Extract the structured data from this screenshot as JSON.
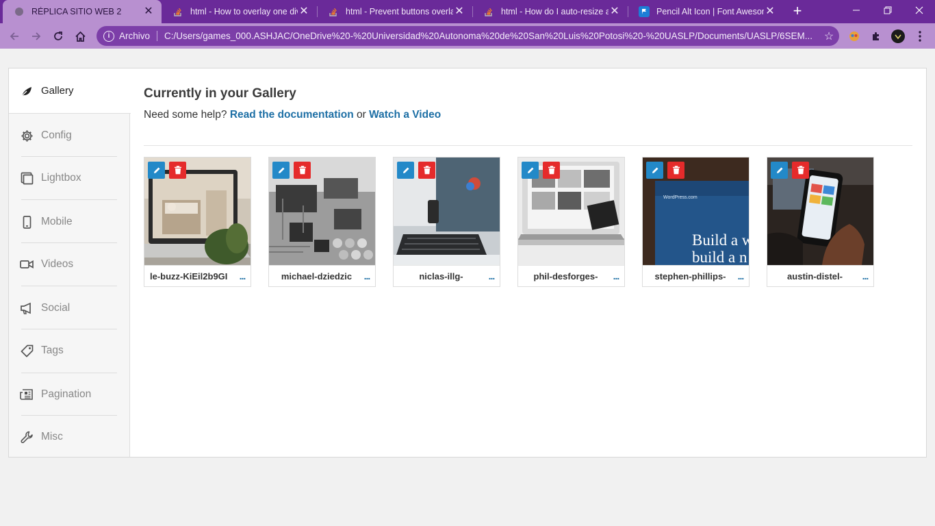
{
  "browser": {
    "tabs": [
      {
        "title": "RÉPLICA SITIO WEB 2",
        "active": true,
        "icon": "globe-icon"
      },
      {
        "title": "html - How to overlay one div",
        "active": false,
        "icon": "stackoverflow-icon"
      },
      {
        "title": "html - Prevent buttons overlap",
        "active": false,
        "icon": "stackoverflow-icon"
      },
      {
        "title": "html - How do I auto-resize an",
        "active": false,
        "icon": "stackoverflow-icon"
      },
      {
        "title": "Pencil Alt Icon | Font Awesome",
        "active": false,
        "icon": "font-awesome-flag-icon"
      }
    ],
    "new_tab": "+",
    "close_symbol": "✕",
    "address_chip": "Archivo",
    "url": "C:/Users/games_000.ASHJAC/OneDrive%20-%20Universidad%20Autonoma%20de%20San%20Luis%20Potosi%20-%20UASLP/Documents/UASLP/6SEM...",
    "colors": {
      "tabstrip": "#6a2a99",
      "toolbar": "#b890d0",
      "omnibox": "#7c3ea8"
    }
  },
  "sidebar": {
    "active": {
      "label": "Gallery",
      "icon": "leaf-icon"
    },
    "items": [
      {
        "label": "Config",
        "icon": "gear-icon"
      },
      {
        "label": "Lightbox",
        "icon": "clone-icon"
      },
      {
        "label": "Mobile",
        "icon": "mobile-icon"
      },
      {
        "label": "Videos",
        "icon": "video-icon"
      },
      {
        "label": "Social",
        "icon": "megaphone-icon"
      },
      {
        "label": "Tags",
        "icon": "tag-icon"
      },
      {
        "label": "Pagination",
        "icon": "newspaper-icon"
      },
      {
        "label": "Misc",
        "icon": "wrench-icon"
      }
    ]
  },
  "main": {
    "heading": "Currently in your Gallery",
    "help_prefix": "Need some help?",
    "help_link_docs": "Read the documentation",
    "help_or": "or",
    "help_link_video": "Watch a Video",
    "more_symbol": "...",
    "accent_colors": {
      "edit": "#2389c8",
      "delete": "#e52b2b",
      "link": "#1d6fa5"
    },
    "images": [
      {
        "filename": "le-buzz-KiEil2b9GI",
        "subject": "laptop showing room photo, plant"
      },
      {
        "filename": "michael-dziedzic",
        "subject": "circuit board close-up"
      },
      {
        "filename": "niclas-illg-",
        "subject": "desktop monitor and keyboard"
      },
      {
        "filename": "phil-desforges-",
        "subject": "laptop with photo grid"
      },
      {
        "filename": "stephen-phillips-",
        "subject": "screen showing WordPress page"
      },
      {
        "filename": "austin-distel-",
        "subject": "hand holding smartphone"
      }
    ],
    "thumbnail_texts": {
      "wordpress_banner": "WordPress.com",
      "wordpress_line1": "Build a w",
      "wordpress_line2": "build a n"
    }
  }
}
